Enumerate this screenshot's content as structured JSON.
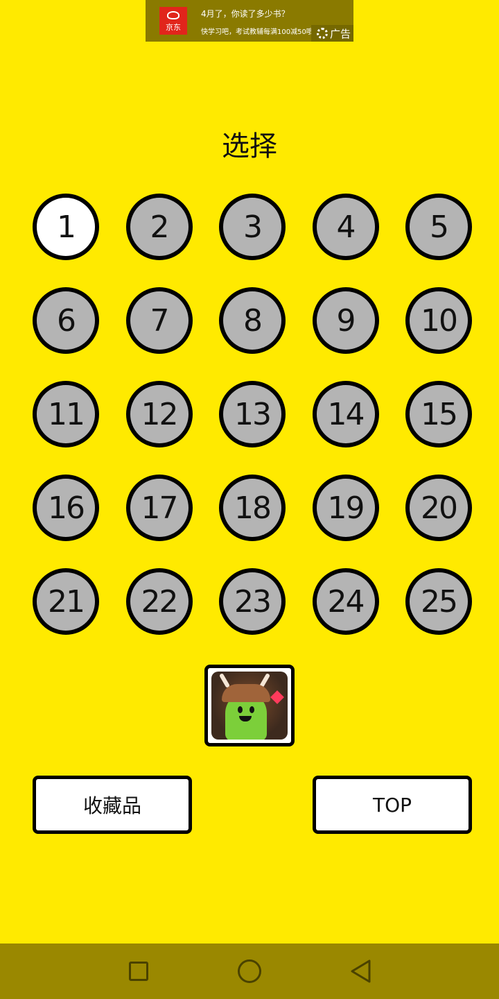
{
  "ad": {
    "brand": "京东",
    "title": "4月了，你读了多少书？",
    "subtitle": "快学习吧，考试教辅每满100减50哦！",
    "badge": "广告"
  },
  "page": {
    "title": "选择"
  },
  "levels": [
    {
      "label": "1",
      "state": "unlocked"
    },
    {
      "label": "2",
      "state": "locked"
    },
    {
      "label": "3",
      "state": "locked"
    },
    {
      "label": "4",
      "state": "locked"
    },
    {
      "label": "5",
      "state": "locked"
    },
    {
      "label": "6",
      "state": "locked"
    },
    {
      "label": "7",
      "state": "locked"
    },
    {
      "label": "8",
      "state": "locked"
    },
    {
      "label": "9",
      "state": "locked"
    },
    {
      "label": "10",
      "state": "locked"
    },
    {
      "label": "11",
      "state": "locked"
    },
    {
      "label": "12",
      "state": "locked"
    },
    {
      "label": "13",
      "state": "locked"
    },
    {
      "label": "14",
      "state": "locked"
    },
    {
      "label": "15",
      "state": "locked"
    },
    {
      "label": "16",
      "state": "locked"
    },
    {
      "label": "17",
      "state": "locked"
    },
    {
      "label": "18",
      "state": "locked"
    },
    {
      "label": "19",
      "state": "locked"
    },
    {
      "label": "20",
      "state": "locked"
    },
    {
      "label": "21",
      "state": "locked"
    },
    {
      "label": "22",
      "state": "locked"
    },
    {
      "label": "23",
      "state": "locked"
    },
    {
      "label": "24",
      "state": "locked"
    },
    {
      "label": "25",
      "state": "locked"
    }
  ],
  "buttons": {
    "collection_label": "收藏品",
    "top_label": "TOP"
  },
  "colors": {
    "background": "#FFEA00",
    "level_locked": "#B4B4B4",
    "level_unlocked": "#FFFFFF",
    "nav_bar": "#9A8800"
  },
  "nav": {
    "icons": [
      "recents-icon",
      "home-icon",
      "back-icon"
    ]
  }
}
